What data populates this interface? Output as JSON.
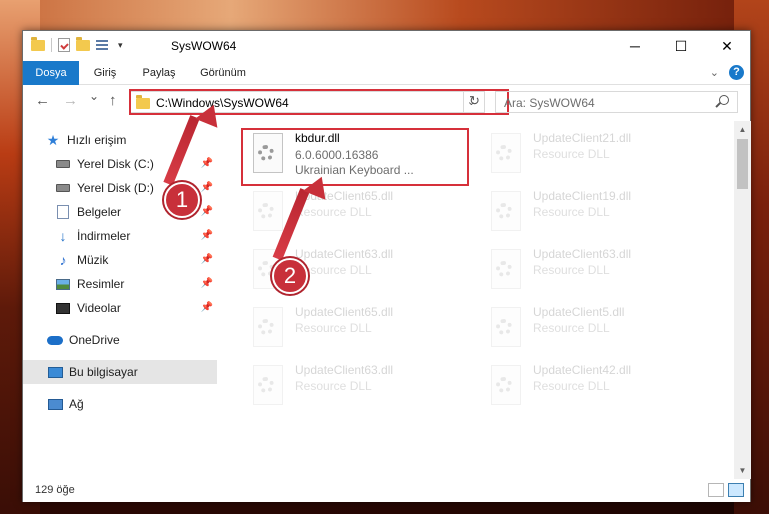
{
  "window": {
    "title": "SysWOW64",
    "minimize": "─",
    "maximize": "☐",
    "close": "✕"
  },
  "ribbon": {
    "tabs": [
      "Dosya",
      "Giriş",
      "Paylaş",
      "Görünüm"
    ],
    "help": "?"
  },
  "navbar": {
    "back": "←",
    "forward": "→",
    "recent": "⌄",
    "up": "↑",
    "address": "C:\\Windows\\SysWOW64",
    "search_placeholder": "Ara: SysWOW64"
  },
  "sidebar": {
    "items": [
      {
        "label": "Hızlı erişim",
        "icon": "star-icon"
      },
      {
        "label": "Yerel Disk (C:)",
        "icon": "drive-icon",
        "pinned": true
      },
      {
        "label": "Yerel Disk (D:)",
        "icon": "drive-icon",
        "pinned": true
      },
      {
        "label": "Belgeler",
        "icon": "documents-icon",
        "pinned": true
      },
      {
        "label": "İndirmeler",
        "icon": "download-icon",
        "pinned": true
      },
      {
        "label": "Müzik",
        "icon": "music-icon",
        "pinned": true
      },
      {
        "label": "Resimler",
        "icon": "pictures-icon",
        "pinned": true
      },
      {
        "label": "Videolar",
        "icon": "videos-icon",
        "pinned": true
      },
      {
        "label": "OneDrive",
        "icon": "cloud-icon"
      },
      {
        "label": "Bu bilgisayar",
        "icon": "computer-icon",
        "selected": true
      },
      {
        "label": "Ağ",
        "icon": "network-icon"
      }
    ]
  },
  "files": {
    "selected": {
      "name": "kbdur.dll",
      "version": "6.0.6000.16386",
      "description": "Ukrainian Keyboard ..."
    },
    "ghost": [
      {
        "name": "UpdateClient21.dll",
        "desc": "Resource DLL"
      },
      {
        "name": "UpdateClient65.dll",
        "desc": "Resource DLL"
      },
      {
        "name": "UpdateClient19.dll",
        "desc": "Resource DLL"
      },
      {
        "name": "UpdateClient63.dll",
        "desc": "Resource DLL"
      },
      {
        "name": "UpdateClient63.dll",
        "desc": "Resource DLL"
      },
      {
        "name": "UpdateClient65.dll",
        "desc": "Resource DLL"
      },
      {
        "name": "UpdateClient5.dll",
        "desc": "Resource DLL"
      },
      {
        "name": "UpdateClient63.dll",
        "desc": "Resource DLL"
      },
      {
        "name": "UpdateClient42.dll",
        "desc": "Resource DLL"
      }
    ]
  },
  "status": {
    "item_count": "129 öğe"
  },
  "annotations": {
    "step1": "1",
    "step2": "2",
    "color": "#c8303a"
  }
}
